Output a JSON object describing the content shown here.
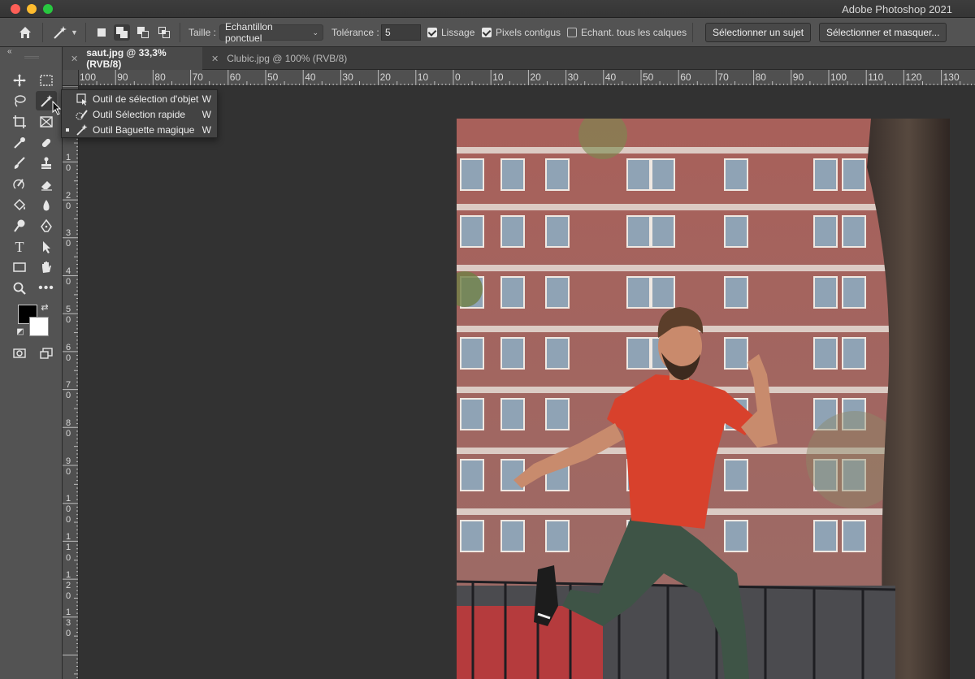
{
  "window": {
    "app_title": "Adobe Photoshop 2021",
    "traffic_lights": [
      "close",
      "minimize",
      "zoom"
    ]
  },
  "options_bar": {
    "home_icon": "home-icon",
    "tool_icon": "magic-wand-icon",
    "size_label": "Taille :",
    "size_value": "Echantillon ponctuel",
    "tolerance_label": "Tolérance :",
    "tolerance_value": "5",
    "checkboxes": [
      {
        "label": "Lissage",
        "checked": true
      },
      {
        "label": "Pixels contigus",
        "checked": true
      },
      {
        "label": "Echant. tous les calques",
        "checked": false
      }
    ],
    "select_subject_button": "Sélectionner un sujet",
    "select_and_mask_button": "Sélectionner et masquer..."
  },
  "tabs": [
    {
      "label": "saut.jpg @ 33,3% (RVB/8)",
      "active": true
    },
    {
      "label": "Clubic.jpg @ 100% (RVB/8)",
      "active": false
    }
  ],
  "ruler": {
    "h_labels": [
      "100",
      "90",
      "80",
      "70",
      "60",
      "50",
      "40",
      "30",
      "20",
      "10",
      "0",
      "10",
      "20",
      "30",
      "40",
      "50",
      "60",
      "70",
      "80",
      "90",
      "100",
      "110",
      "120",
      "130"
    ],
    "v_labels": [
      "1 0",
      "2 0",
      "3 0",
      "4 0",
      "5 0",
      "6 0",
      "7 0",
      "8 0",
      "9 0",
      "1 0 0",
      "1 1 0",
      "1 2 0",
      "1 3 0"
    ]
  },
  "flyout": {
    "items": [
      {
        "label": "Outil de sélection d'objet",
        "shortcut": "W",
        "selected": false
      },
      {
        "label": "Outil Sélection rapide",
        "shortcut": "W",
        "selected": false
      },
      {
        "label": "Outil Baguette magique",
        "shortcut": "W",
        "selected": true
      }
    ]
  },
  "colors": {
    "foreground": "#000000",
    "background": "#ffffff",
    "shirt": "#d8412c"
  }
}
